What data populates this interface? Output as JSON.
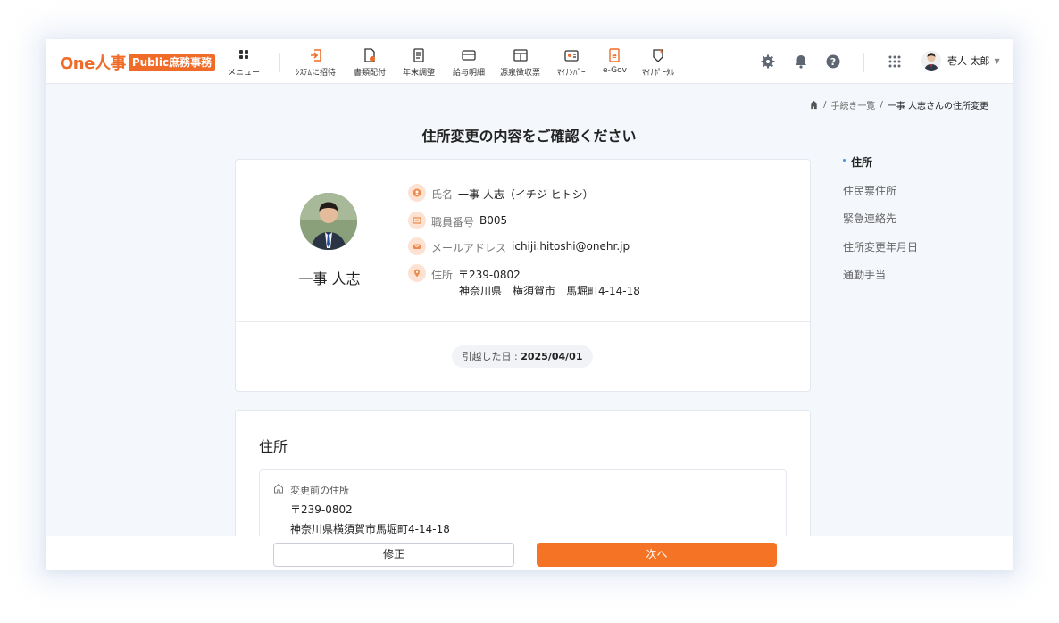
{
  "header": {
    "logo": {
      "main": "One人事",
      "badge": "Public庶務事務"
    },
    "nav": [
      {
        "icon": "grid-menu-icon",
        "label": "メニュー"
      },
      {
        "icon": "invite-icon",
        "label": "ｼｽﾃﾑに招待"
      },
      {
        "icon": "document-send-icon",
        "label": "書類配付"
      },
      {
        "icon": "year-end-icon",
        "label": "年末調整"
      },
      {
        "icon": "payslip-icon",
        "label": "給与明細"
      },
      {
        "icon": "withholding-icon",
        "label": "源泉徴収票"
      },
      {
        "icon": "mynumber-icon",
        "label": "ﾏｲﾅﾝﾊﾞｰ"
      },
      {
        "icon": "egov-icon",
        "label": "e-Gov"
      },
      {
        "icon": "myna-portal-icon",
        "label": "ﾏｲﾅﾎﾟｰﾀﾙ"
      }
    ],
    "user_name": "壱人 太郎"
  },
  "breadcrumb": {
    "items": [
      "手続き一覧",
      "一事 人志さんの住所変更"
    ]
  },
  "page_title": "住所変更の内容をご確認ください",
  "profile": {
    "display_name": "一事 人志",
    "name_label": "氏名",
    "name_value": "一事 人志（イチジ ヒトシ）",
    "employee_no_label": "職員番号",
    "employee_no_value": "B005",
    "email_label": "メールアドレス",
    "email_value": "ichiji.hitoshi@onehr.jp",
    "address_label": "住所",
    "address_zip": "〒239-0802",
    "address_line": "神奈川県　横須賀市　馬堀町4-14-18",
    "move_date_label": "引越した日 : ",
    "move_date_value": "2025/04/01"
  },
  "address_section": {
    "title": "住所",
    "before_label": "変更前の住所",
    "before_zip": "〒239-0802",
    "before_line": "神奈川県横須賀市馬堀町4-14-18"
  },
  "side_nav": [
    {
      "label": "住所",
      "active": true
    },
    {
      "label": "住民票住所",
      "active": false
    },
    {
      "label": "緊急連絡先",
      "active": false
    },
    {
      "label": "住所変更年月日",
      "active": false
    },
    {
      "label": "通勤手当",
      "active": false
    }
  ],
  "footer": {
    "edit_label": "修正",
    "next_label": "次へ"
  },
  "colors": {
    "brand": "#ef6b27",
    "primary_button": "#f47324",
    "icon_bg": "#fde2d3",
    "active_bullet": "#4a90e2"
  }
}
